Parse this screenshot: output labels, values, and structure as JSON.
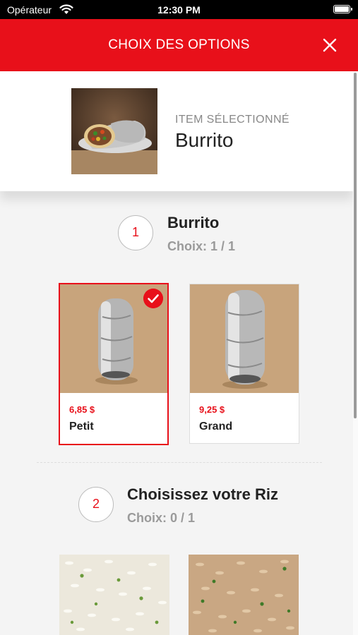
{
  "status_bar": {
    "carrier": "Opérateur",
    "time": "12:30 PM"
  },
  "header": {
    "title": "CHOIX DES OPTIONS"
  },
  "selected_item": {
    "subtitle": "ITEM SÉLECTIONNÉ",
    "name": "Burrito"
  },
  "steps": [
    {
      "number": "1",
      "title": "Burrito",
      "choice": "Choix: 1 / 1",
      "options": [
        {
          "price": "6,85 $",
          "label": "Petit",
          "selected": true
        },
        {
          "price": "9,25 $",
          "label": "Grand",
          "selected": false
        }
      ]
    },
    {
      "number": "2",
      "title": "Choisissez votre Riz",
      "choice": "Choix: 0 / 1"
    }
  ],
  "colors": {
    "accent": "#e8101a",
    "header_bg": "#e8101a",
    "muted": "#9a9a9a"
  }
}
